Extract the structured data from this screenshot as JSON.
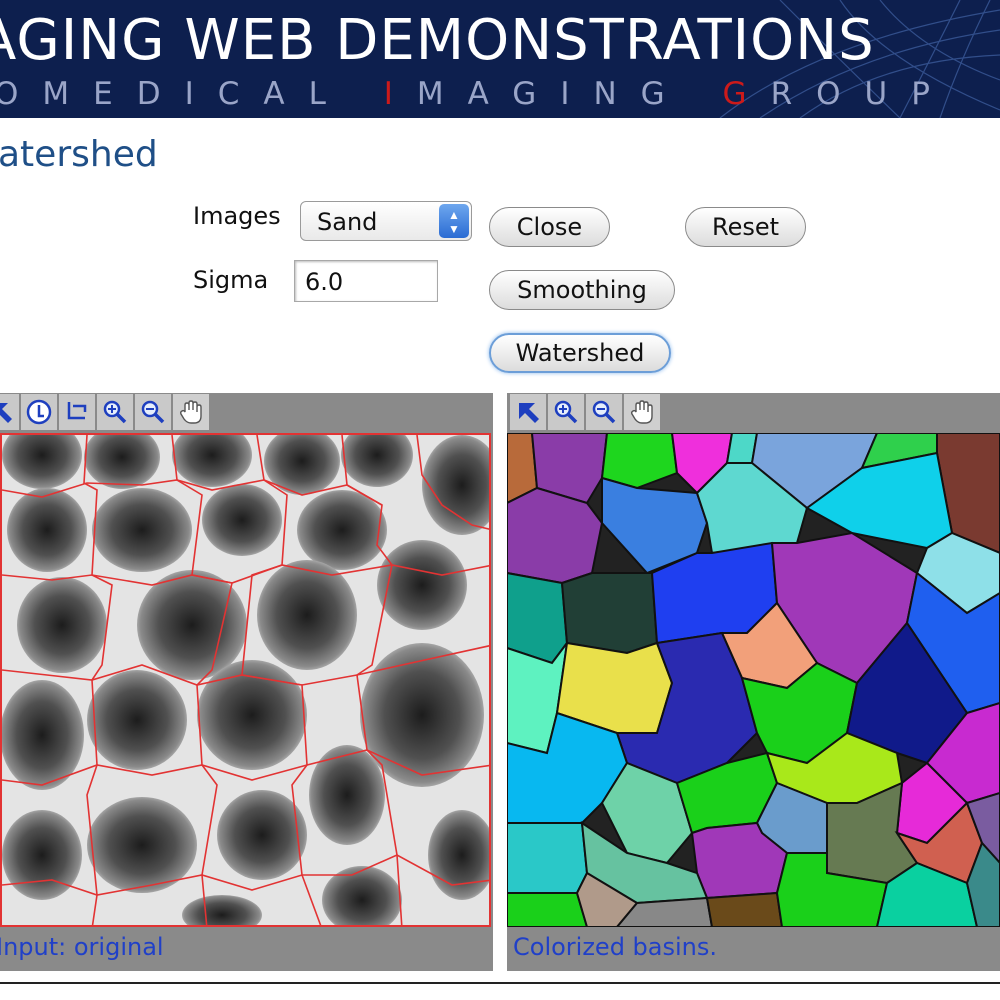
{
  "banner": {
    "title": "AGING WEB DEMONSTRATIONS",
    "subtitle_parts": [
      "OMEDICAL ",
      "I",
      "MAGING ",
      "G",
      "ROUP"
    ]
  },
  "page_title": "atershed",
  "controls": {
    "images_label": "Images",
    "images_selected": "Sand",
    "sigma_label": "Sigma",
    "sigma_value": "6.0"
  },
  "buttons": {
    "close": "Close",
    "reset": "Reset",
    "smoothing": "Smoothing",
    "watershed": "Watershed"
  },
  "left_viewer": {
    "tools": [
      "pointer-arrow-icon",
      "info-icon",
      "profile-line-icon",
      "zoom-in-icon",
      "zoom-out-icon",
      "pan-hand-icon"
    ],
    "caption": "Input: original"
  },
  "right_viewer": {
    "tools": [
      "pointer-arrow-icon",
      "zoom-in-icon",
      "zoom-out-icon",
      "pan-hand-icon"
    ],
    "caption": "Colorized basins."
  },
  "colors": {
    "banner_bg": "#0d1f4e",
    "title_blue": "#1f4f87",
    "caption_blue": "#2040c8",
    "boundary_red": "#e23333"
  }
}
